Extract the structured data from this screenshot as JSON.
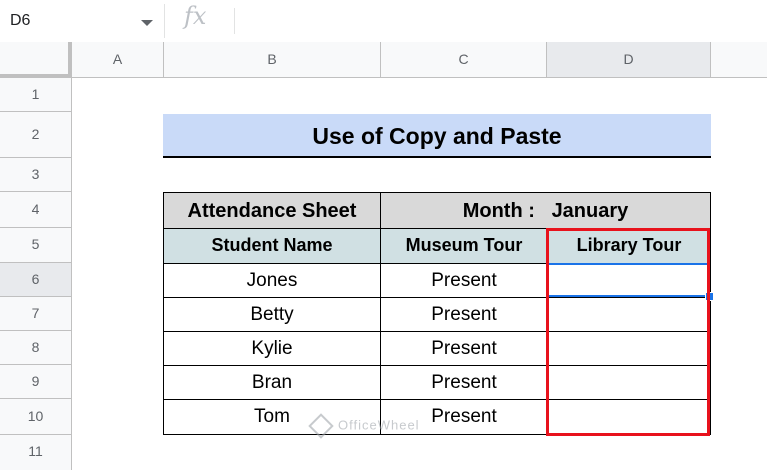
{
  "name_box": {
    "ref": "D6"
  },
  "formula_bar": {
    "fx_label": "fx",
    "value": ""
  },
  "columns": [
    "A",
    "B",
    "C",
    "D"
  ],
  "rows": [
    "1",
    "2",
    "3",
    "4",
    "5",
    "6",
    "7",
    "8",
    "9",
    "10",
    "11"
  ],
  "selected_cell": "D6",
  "sheet": {
    "title": "Use of Copy and Paste",
    "header1": {
      "left": "Attendance Sheet",
      "month_label": "Month :",
      "month_value": "January"
    },
    "header2": [
      "Student Name",
      "Museum Tour",
      "Library Tour"
    ],
    "records": [
      {
        "name": "Jones",
        "museum": "Present",
        "library": ""
      },
      {
        "name": "Betty",
        "museum": "Present",
        "library": ""
      },
      {
        "name": "Kylie",
        "museum": "Present",
        "library": ""
      },
      {
        "name": "Bran",
        "museum": "Present",
        "library": ""
      },
      {
        "name": "Tom",
        "museum": "Present",
        "library": ""
      }
    ]
  },
  "watermark": "OfficeWheel",
  "colors": {
    "title_fill": "#c9daf8",
    "header1_fill": "#d9d9d9",
    "header2_fill": "#d0e0e3",
    "highlight_box": "#e8121c",
    "selection": "#1a73e8"
  }
}
